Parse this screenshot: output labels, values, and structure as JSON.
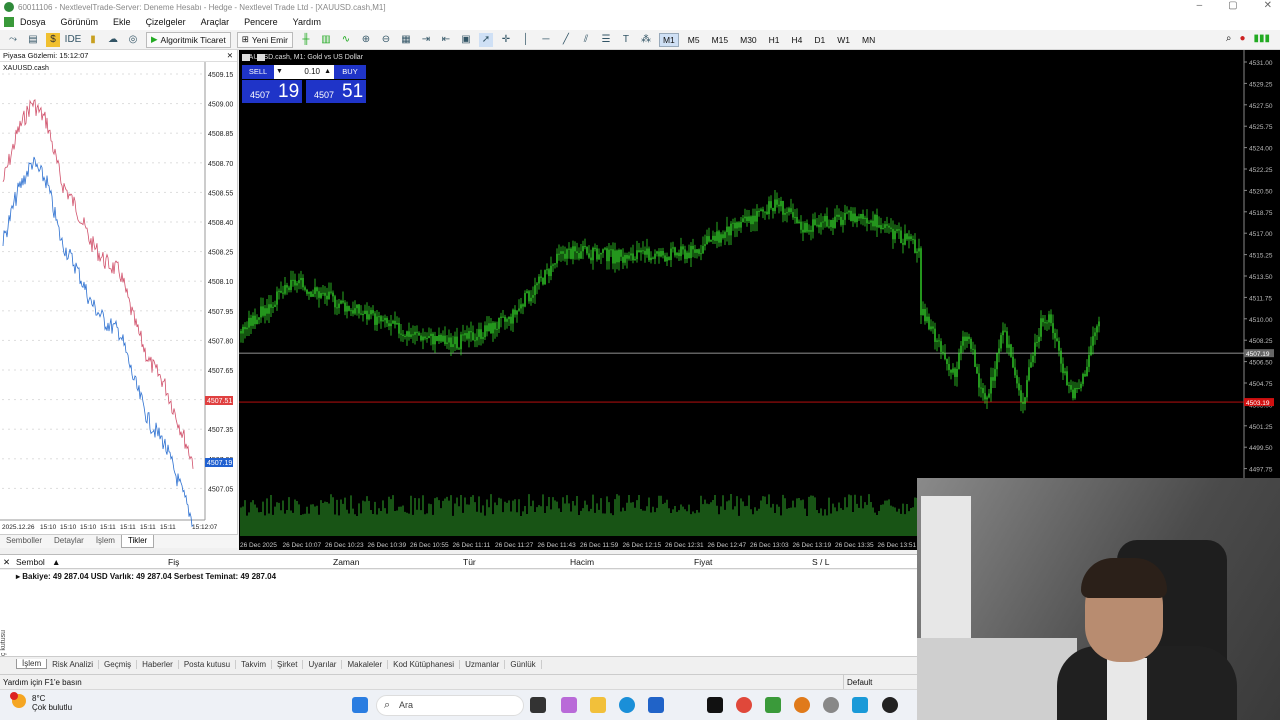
{
  "window": {
    "title": "60011106 - NextlevelTrade-Server: Deneme Hesabı - Hedge - Nextlevel Trade Ltd - [XAUUSD.cash,M1]"
  },
  "menu": [
    "Dosya",
    "Görünüm",
    "Ekle",
    "Çizelgeler",
    "Araçlar",
    "Pencere",
    "Yardım"
  ],
  "toolbar": {
    "ide": "IDE",
    "algo": "Algoritmik Ticaret",
    "new_order": "Yeni Emir",
    "timeframes": [
      "M1",
      "M5",
      "M15",
      "M30",
      "H1",
      "H4",
      "D1",
      "W1",
      "MN"
    ],
    "active_tf": "M1"
  },
  "market_watch": {
    "header": "Piyasa Gözlemi: 15:12:07",
    "symbol": "XAUUSD.cash",
    "price_labels": [
      "4509.15",
      "4509.00",
      "4508.85",
      "4508.70",
      "4508.55",
      "4508.40",
      "4508.25",
      "4508.10",
      "4507.95",
      "4507.80",
      "4507.65",
      "4507.50",
      "4507.35",
      "4507.20",
      "4507.05"
    ],
    "ask_tag": "4507.51",
    "bid_tag": "4507.19",
    "time_labels": [
      "2025.12.26",
      "15:10",
      "15:10",
      "15:10",
      "15:11",
      "15:11",
      "15:11",
      "15:11",
      "15:12:07"
    ],
    "tabs": [
      "Semboller",
      "Detaylar",
      "İşlem",
      "Tikler"
    ],
    "active_tab": "Tikler"
  },
  "chart": {
    "title": "XAUUSD.cash, M1:  Gold vs US Dollar",
    "trade_panel": {
      "sell": "SELL",
      "buy": "BUY",
      "lot": "0.10",
      "bid_small": "4507",
      "bid_big": "19",
      "ask_small": "4507",
      "ask_big": "51"
    },
    "price_axis": [
      "4531.00",
      "4529.25",
      "4527.50",
      "4525.75",
      "4524.00",
      "4522.25",
      "4520.50",
      "4518.75",
      "4517.00",
      "4515.25",
      "4513.50",
      "4511.75",
      "4510.00",
      "4508.25",
      "4506.50",
      "4504.75",
      "4503.00",
      "4501.25",
      "4499.50",
      "4497.75"
    ],
    "bid_tag": "4507.19",
    "ask_tag": "4503.19",
    "time_axis": [
      "26 Dec 2025",
      "26 Dec 10:07",
      "26 Dec 10:23",
      "26 Dec 10:39",
      "26 Dec 10:55",
      "26 Dec 11:11",
      "26 Dec 11:27",
      "26 Dec 11:43",
      "26 Dec 11:59",
      "26 Dec 12:15",
      "26 Dec 12:31",
      "26 Dec 12:47",
      "26 Dec 13:03",
      "26 Dec 13:19",
      "26 Dec 13:35",
      "26 Dec 13:51"
    ],
    "colors": {
      "up": "#34d62a",
      "down": "#34d62a",
      "bid_line": "#c0c0c0",
      "ask_line": "#d01010"
    }
  },
  "toolbox": {
    "columns": [
      "Sembol",
      "Fiş",
      "Zaman",
      "Tür",
      "Hacim",
      "Fiyat",
      "S / L"
    ],
    "balance": "Bakiye: 49 287.04 USD  Varlık: 49 287.04  Serbest Teminat: 49 287.04",
    "vertical_label": "Araç kutusu",
    "tabs": [
      "İşlem",
      "Risk Analizi",
      "Geçmiş",
      "Haberler",
      "Posta kutusu",
      "Takvim",
      "Şirket",
      "Uyarılar",
      "Makaleler",
      "Kod Kütüphanesi",
      "Uzmanlar",
      "Günlük"
    ],
    "active_tab": "İşlem"
  },
  "status": {
    "help": "Yardım için F1'e basın",
    "profile": "Default"
  },
  "taskbar": {
    "temp": "8°C",
    "weather": "Çok bulutlu",
    "search": "Ara"
  }
}
